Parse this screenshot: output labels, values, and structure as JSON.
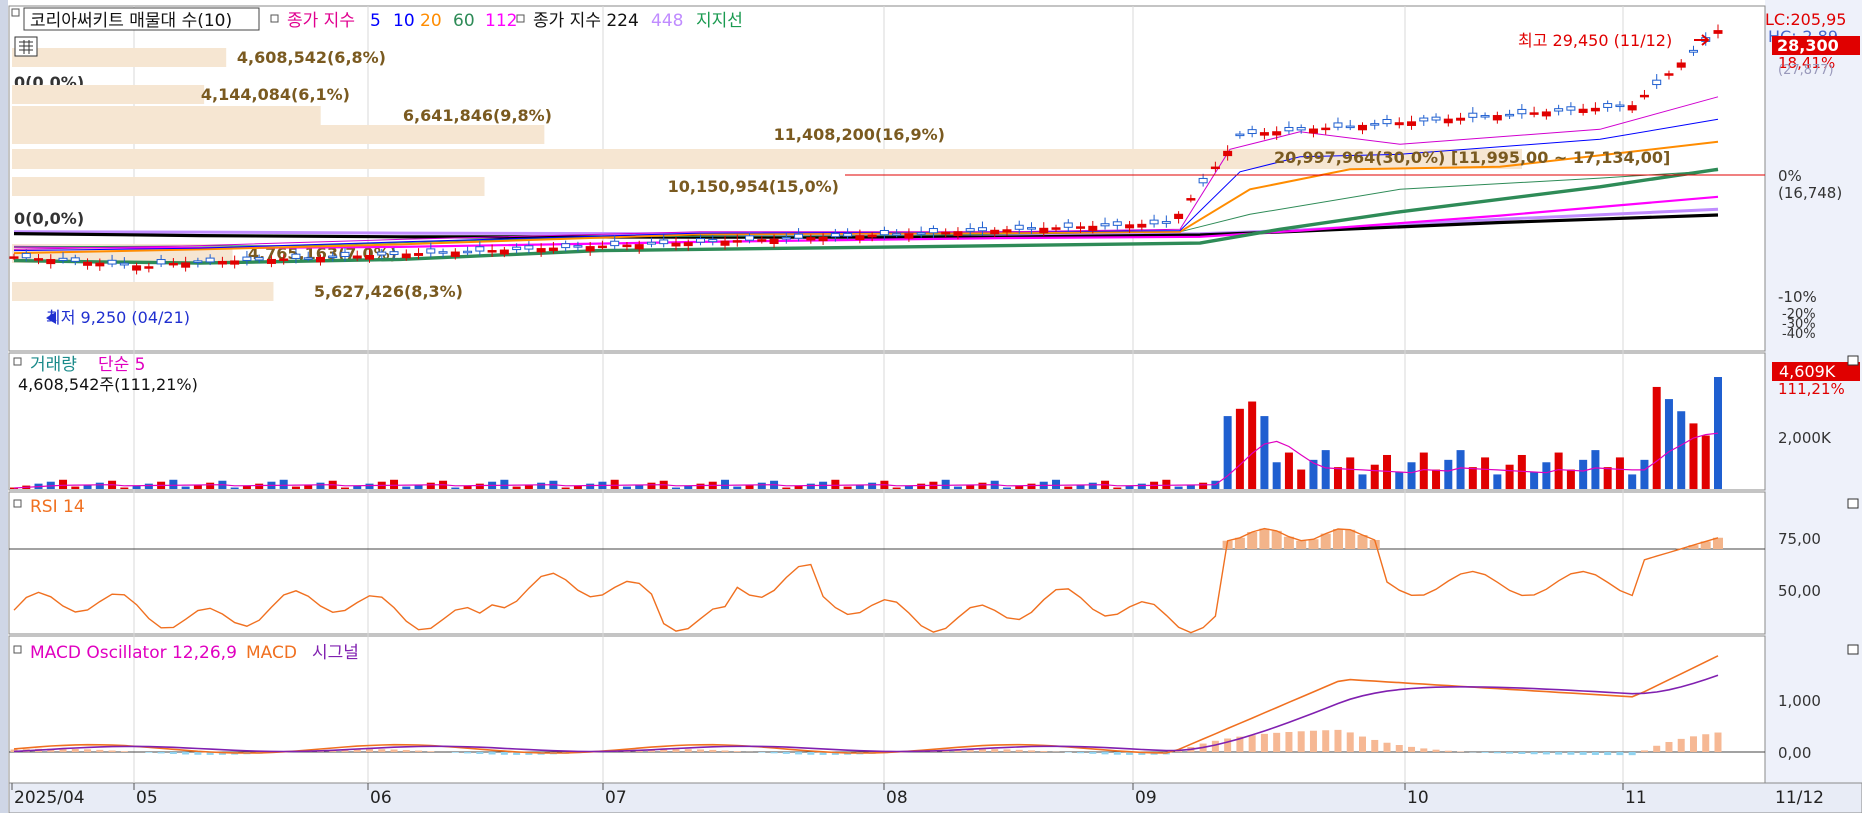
{
  "header": {
    "stock_name": "코리아써키트 매물대 수(10)",
    "ma_title": "종가 지수",
    "ma_periods": [
      "5",
      "10",
      "20",
      "60",
      "112"
    ],
    "ma_colors": [
      "#0000ff",
      "#ff8c00",
      "#2e8b57",
      "#ff00ff",
      "#000000"
    ],
    "ma_title2": "종가 지수 224",
    "ma_long": "448",
    "support_label": "지지선"
  },
  "price_panel": {
    "lc_label": "LC:205,95",
    "hc_label": "HC:-2,89",
    "current_price": "28,300",
    "current_change": "18,41%",
    "current_change_back": "(27,877)",
    "high_label": "최고 29,450 (11/12)",
    "low_label": "최저 9,250 (04/21)",
    "reference_label": "20,997,964(30,0%) [11,995,00 ~ 17,134,00]",
    "right_axis": [
      {
        "label": "0%",
        "value": 0
      },
      {
        "label": "(16,748)",
        "value": null
      },
      {
        "label": "-10%",
        "value": -10
      },
      {
        "label": "-20%",
        "value": -20
      },
      {
        "label": "-30%",
        "value": -30
      },
      {
        "label": "-40%",
        "value": -40
      }
    ],
    "volume_profile": [
      {
        "label": "4,608,542(6,8%)",
        "pct": 6.8
      },
      {
        "label": "0(0,0%)",
        "pct": 0
      },
      {
        "label": "4,144,084(6,1%)",
        "pct": 6.1
      },
      {
        "label": "6,641,846(9,8%)",
        "pct": 9.8
      },
      {
        "label": "11,408,200(16,9%)",
        "pct": 16.9
      },
      {
        "label": "20,997,964(30,0%)",
        "pct": 30.0
      },
      {
        "label": "10,150,954(15,0%)",
        "pct": 15.0
      },
      {
        "label": "0(0,0%)",
        "pct": 0
      },
      {
        "label": "4,765,163(7,0%)",
        "pct": 7.0
      },
      {
        "label": "5,627,426(8,3%)",
        "pct": 8.3
      }
    ]
  },
  "volume_panel": {
    "title": "거래량",
    "ma_label": "단순 5",
    "summary": "4,608,542주(111,21%)",
    "current": "4,609K",
    "current_pct": "111,21%",
    "axis_label": "2,000K"
  },
  "rsi_panel": {
    "title": "RSI 14",
    "axis": [
      "75,00",
      "50,00"
    ]
  },
  "macd_panel": {
    "title": "MACD Oscillator 12,26,9",
    "macd_label": "MACD",
    "signal_label": "시그널",
    "axis": [
      "1,000",
      "0,00"
    ]
  },
  "x_axis": {
    "labels": [
      "2025/04",
      "05",
      "06",
      "07",
      "08",
      "09",
      "10",
      "11"
    ],
    "end_label": "11/12"
  },
  "chart_data": {
    "type": "line",
    "title": "코리아써키트",
    "x_range": [
      "2025/04",
      "11/12"
    ],
    "price_close_approx": [
      {
        "x": "2025/04",
        "y": 10200
      },
      {
        "x": "04/21",
        "y": 9250
      },
      {
        "x": "05",
        "y": 10600
      },
      {
        "x": "06",
        "y": 11900
      },
      {
        "x": "07",
        "y": 12700
      },
      {
        "x": "08",
        "y": 12700
      },
      {
        "x": "09",
        "y": 13200
      },
      {
        "x": "09/15",
        "y": 19800
      },
      {
        "x": "10",
        "y": 20500
      },
      {
        "x": "11",
        "y": 22500
      },
      {
        "x": "11/12",
        "y": 28300
      }
    ],
    "high": {
      "date": "11/12",
      "value": 29450
    },
    "low": {
      "date": "04/21",
      "value": 9250
    },
    "volume_last": 4608542,
    "rsi_range": [
      50,
      75
    ],
    "macd_axis": [
      0,
      1000
    ]
  }
}
